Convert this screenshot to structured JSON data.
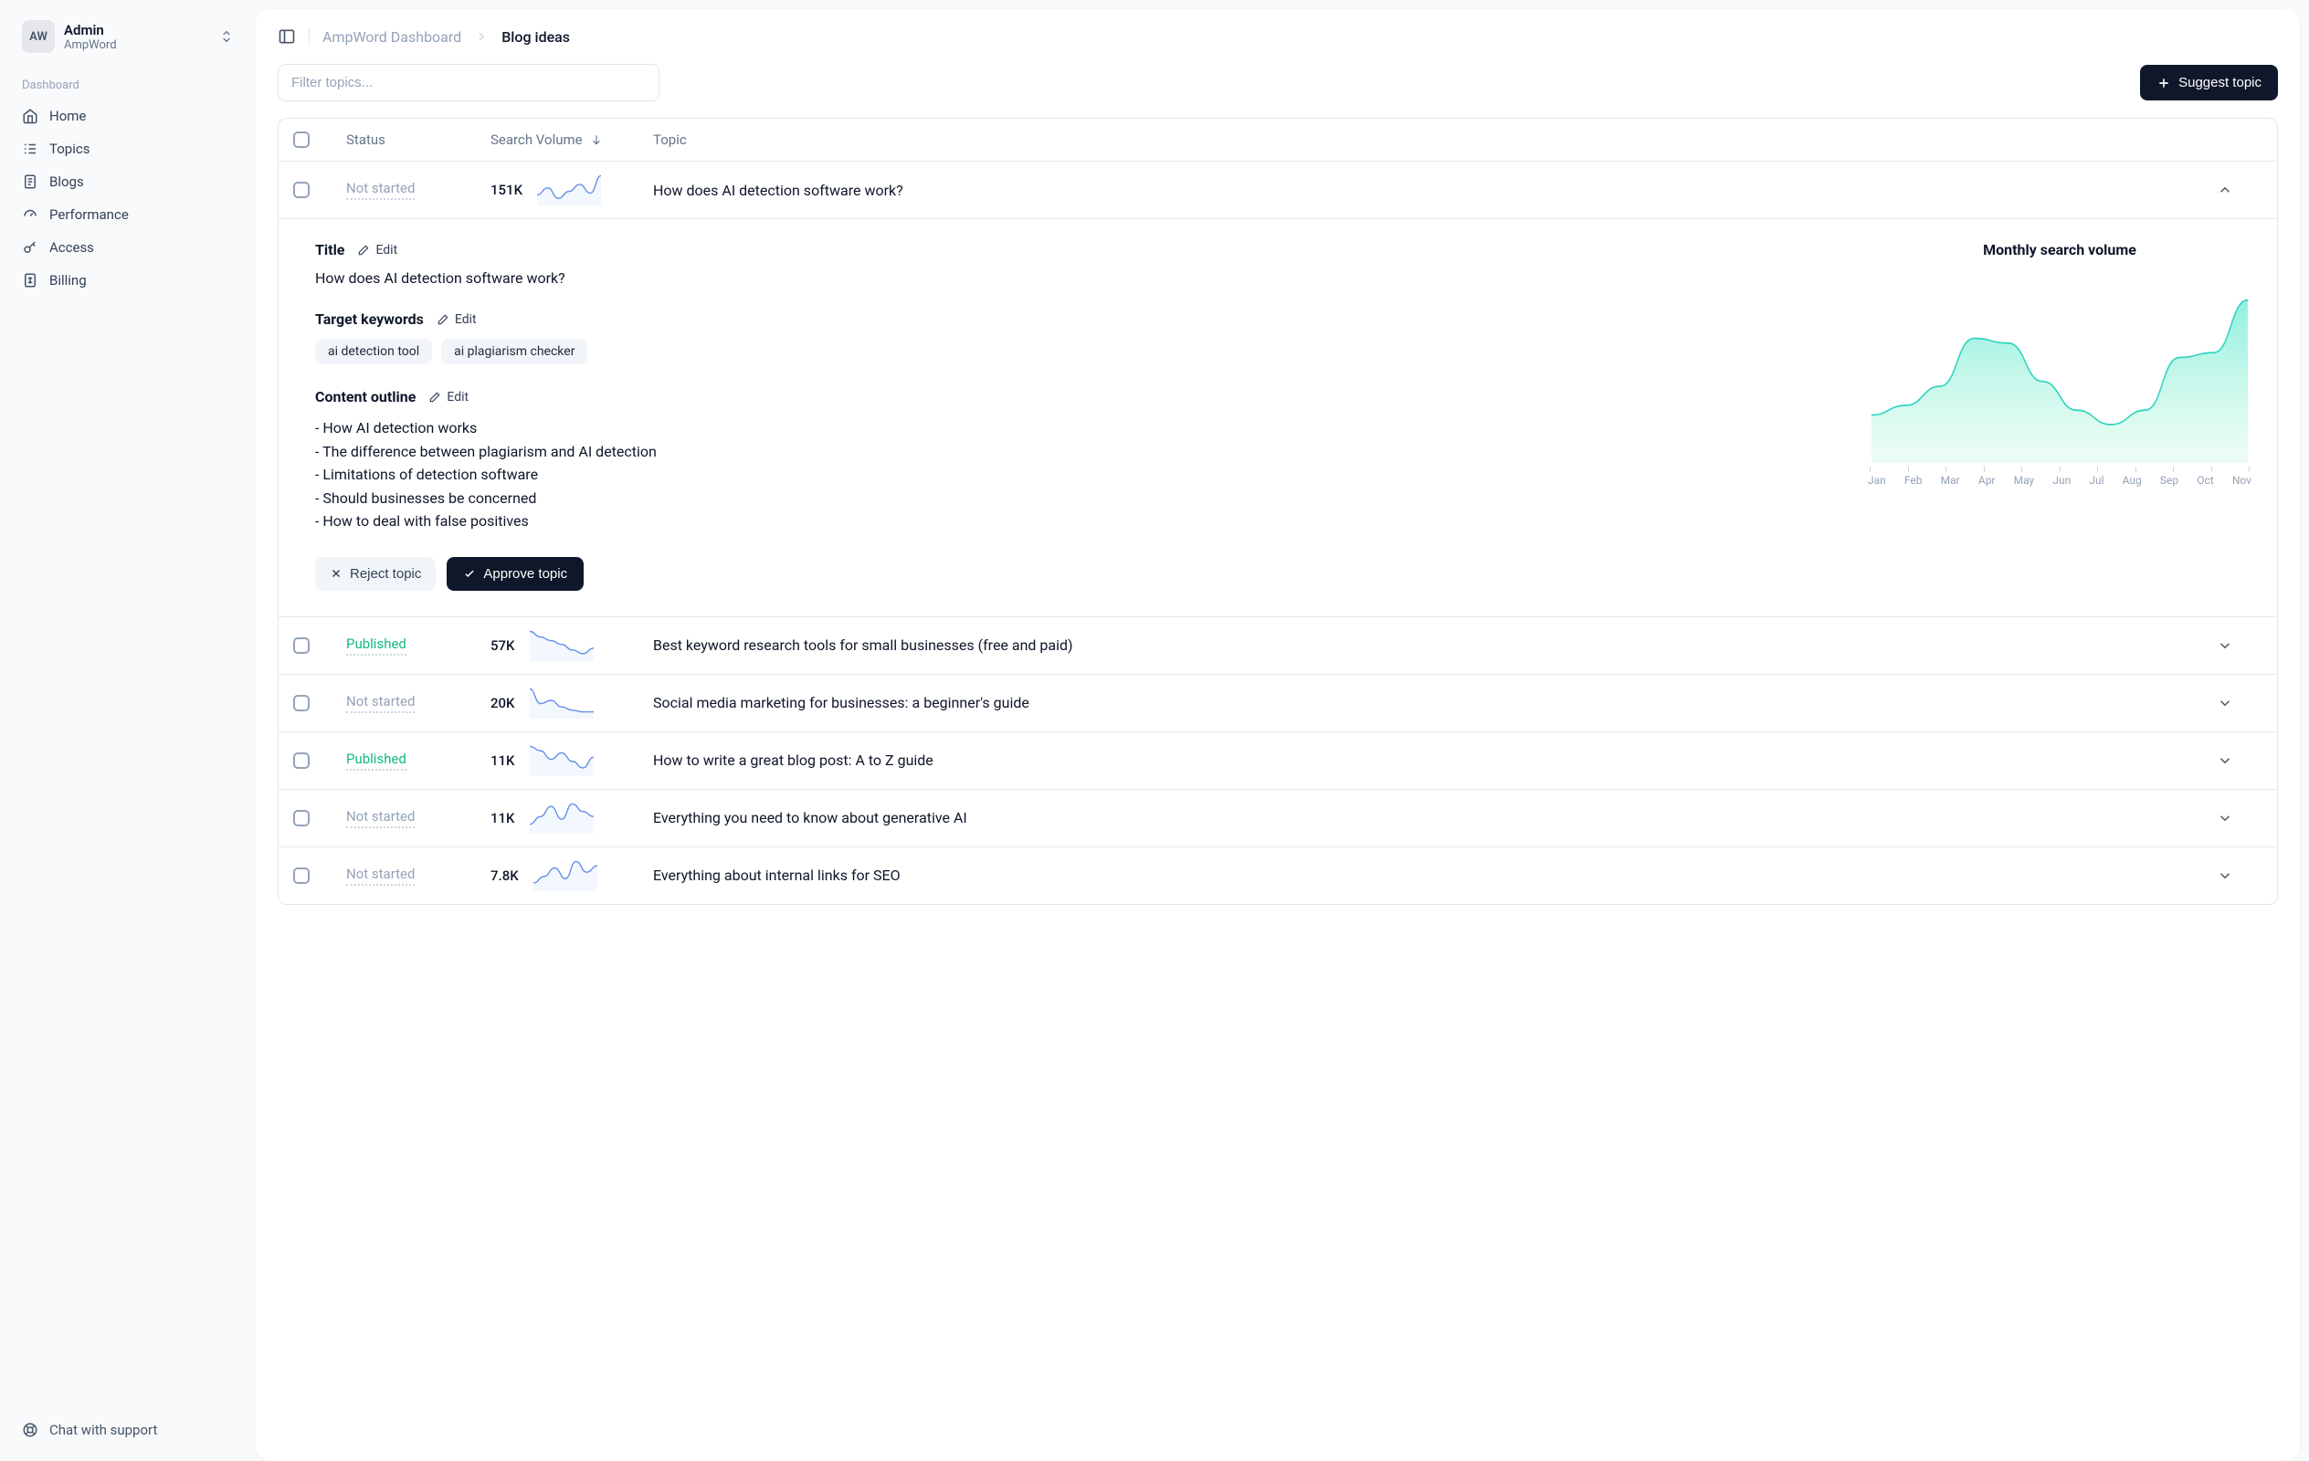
{
  "sidebar": {
    "user_initials": "AW",
    "user_name": "Admin",
    "workspace": "AmpWord",
    "section_label": "Dashboard",
    "items": [
      {
        "label": "Home",
        "icon": "home"
      },
      {
        "label": "Topics",
        "icon": "topics"
      },
      {
        "label": "Blogs",
        "icon": "blogs"
      },
      {
        "label": "Performance",
        "icon": "performance"
      },
      {
        "label": "Access",
        "icon": "access"
      },
      {
        "label": "Billing",
        "icon": "billing"
      }
    ],
    "footer_label": "Chat with support"
  },
  "breadcrumb": {
    "parent": "AmpWord Dashboard",
    "current": "Blog ideas"
  },
  "actions": {
    "filter_placeholder": "Filter topics...",
    "suggest_label": "Suggest topic"
  },
  "table": {
    "columns": {
      "status": "Status",
      "volume": "Search Volume",
      "topic": "Topic"
    },
    "rows": [
      {
        "status": "Not started",
        "status_type": "not-started",
        "volume": "151K",
        "title": "How does AI detection software work?",
        "expanded": true,
        "spark": [
          30,
          38,
          26,
          34,
          42,
          32,
          52
        ]
      },
      {
        "status": "Published",
        "status_type": "published",
        "volume": "57K",
        "title": "Best keyword research tools for small businesses (free and paid)",
        "expanded": false,
        "spark": [
          50,
          44,
          40,
          36,
          30,
          26,
          32
        ]
      },
      {
        "status": "Not started",
        "status_type": "not-started",
        "volume": "20K",
        "title": "Social media marketing for businesses: a beginner's guide",
        "expanded": false,
        "spark": [
          48,
          30,
          34,
          26,
          22,
          20,
          20
        ]
      },
      {
        "status": "Published",
        "status_type": "published",
        "volume": "11K",
        "title": "How to write a great blog post: A to Z guide",
        "expanded": false,
        "spark": [
          40,
          36,
          28,
          34,
          26,
          20,
          30
        ]
      },
      {
        "status": "Not started",
        "status_type": "not-started",
        "volume": "11K",
        "title": "Everything you need to know about generative AI",
        "expanded": false,
        "spark": [
          24,
          30,
          38,
          28,
          40,
          34,
          30
        ]
      },
      {
        "status": "Not started",
        "status_type": "not-started",
        "volume": "7.8K",
        "title": "Everything about internal links for SEO",
        "expanded": false,
        "spark": [
          26,
          32,
          40,
          30,
          46,
          36,
          42
        ]
      }
    ]
  },
  "detail": {
    "title_label": "Title",
    "edit_label": "Edit",
    "title_value": "How does AI detection software work?",
    "keywords_label": "Target keywords",
    "keywords": [
      "ai detection tool",
      "ai plagiarism checker"
    ],
    "outline_label": "Content outline",
    "outline_items": [
      "How AI detection works",
      "The difference between plagiarism and AI detection",
      "Limitations of detection software",
      "Should businesses be concerned",
      "How to deal with false positives"
    ],
    "reject_label": "Reject topic",
    "approve_label": "Approve topic",
    "chart_title": "Monthly search volume"
  },
  "chart_data": {
    "type": "area",
    "title": "Monthly search volume",
    "categories": [
      "Jan",
      "Feb",
      "Mar",
      "Apr",
      "May",
      "Jun",
      "Jul",
      "Aug",
      "Sep",
      "Oct",
      "Nov"
    ],
    "values": [
      50,
      60,
      80,
      130,
      125,
      85,
      55,
      40,
      55,
      110,
      115,
      170
    ],
    "xlabel": "",
    "ylabel": "",
    "ylim": [
      0,
      200
    ]
  }
}
